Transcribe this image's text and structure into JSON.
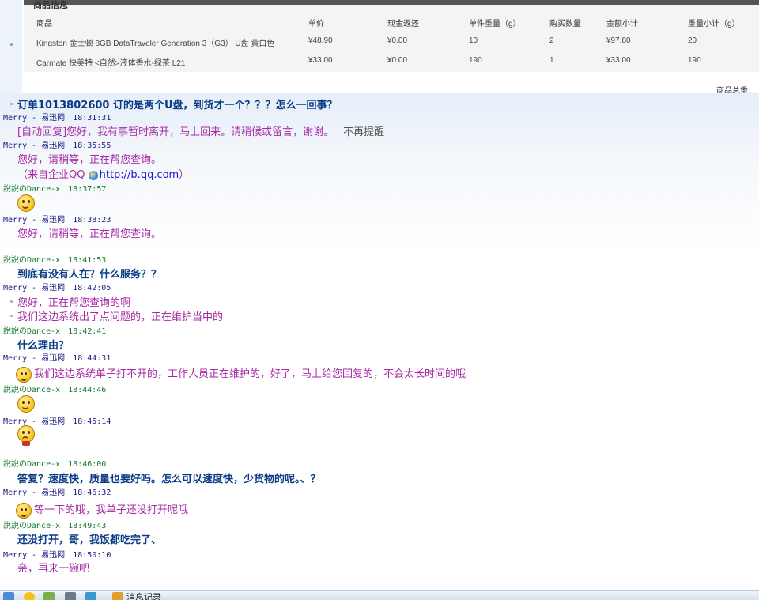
{
  "order": {
    "section_title_cut": "商品信息",
    "columns": [
      "商品",
      "单价",
      "现金返还",
      "单件重量（g）",
      "购买数量",
      "金额小计",
      "重量小计（g）"
    ],
    "rows": [
      [
        "Kingston 金士顿 8GB DataTraveler Generation 3（G3） U盘 黄白色",
        "¥48.90",
        "¥0.00",
        "10",
        "2",
        "¥97.80",
        "20"
      ],
      [
        "Carmate 快美特 <自然>液体香水-绿茶 L21",
        "¥33.00",
        "¥0.00",
        "190",
        "1",
        "¥33.00",
        "190"
      ]
    ],
    "footer_label": "商品总重："
  },
  "chat": [
    {
      "type": "text",
      "role": "cust",
      "text": "订单1013802600 订的是两个U盘，到货才一个？？？怎么一回事？"
    },
    {
      "type": "header",
      "role": "merry",
      "name": "Merry - 易迅网",
      "time": "18:31:31"
    },
    {
      "type": "text",
      "role": "agent",
      "text": "[自动回复]您好，我有事暂时离开，马上回来。请稍候或留言，谢谢。",
      "extra": "不再提醒"
    },
    {
      "type": "header",
      "role": "merry",
      "name": "Merry - 易迅网",
      "time": "18:35:55"
    },
    {
      "type": "text",
      "role": "agent",
      "text": "您好，请稍等，正在帮您查询。"
    },
    {
      "type": "text",
      "role": "agent",
      "text": "（来自企业QQ ",
      "link": "http://b.qq.com",
      "suffix": "）"
    },
    {
      "type": "header",
      "role": "dance",
      "name": "說說のDance-x",
      "time": "18:37:57"
    },
    {
      "type": "emoticon",
      "icon": "grin-emoticon"
    },
    {
      "type": "header",
      "role": "merry",
      "name": "Merry - 易迅网",
      "time": "18:38:23"
    },
    {
      "type": "text",
      "role": "agent",
      "text": "您好，请稍等，正在帮您查询。"
    },
    {
      "type": "header",
      "role": "dance",
      "name": "說說のDance-x",
      "time": "18:41:53"
    },
    {
      "type": "text",
      "role": "cust",
      "text": "到底有没有人在？什么服务？？"
    },
    {
      "type": "header",
      "role": "merry",
      "name": "Merry - 易迅网",
      "time": "18:42:05"
    },
    {
      "type": "text",
      "role": "agent",
      "text": "您好，正在帮您查询的啊"
    },
    {
      "type": "text",
      "role": "agent",
      "text": "我们这边系统出了点问题的，正在维护当中的"
    },
    {
      "type": "header",
      "role": "dance",
      "name": "說說のDance-x",
      "time": "18:42:41"
    },
    {
      "type": "text",
      "role": "cust",
      "text": "什么理由？"
    },
    {
      "type": "header",
      "role": "merry",
      "name": "Merry - 易迅网",
      "time": "18:44:31"
    },
    {
      "type": "text",
      "role": "agent",
      "text": "我们这边系统单子打不开的，工作人员正在维护的，好了，马上给您回复的，不会太长时间的哦"
    },
    {
      "type": "header",
      "role": "dance",
      "name": "說說のDance-x",
      "time": "18:44:46"
    },
    {
      "type": "emoticon",
      "icon": "shocked-emoticon"
    },
    {
      "type": "header",
      "role": "merry",
      "name": "Merry - 易迅网",
      "time": "18:45:14"
    },
    {
      "type": "emoticon",
      "icon": "sad-bow-emoticon"
    },
    {
      "type": "header",
      "role": "dance",
      "name": "說說のDance-x",
      "time": "18:46:00"
    },
    {
      "type": "text",
      "role": "cust",
      "text": "答复？速度快，质量也要好吗。怎么可以速度快，少货物的呢。、？"
    },
    {
      "type": "header",
      "role": "merry",
      "name": "Merry - 易迅网",
      "time": "18:46:32"
    },
    {
      "type": "text",
      "role": "agent",
      "text": "等一下的哦，我单子还没打开呢哦"
    },
    {
      "type": "header",
      "role": "dance",
      "name": "說說のDance-x",
      "time": "18:49:43"
    },
    {
      "type": "text",
      "role": "cust",
      "text": "还没打开，哥，我饭都吃完了、"
    },
    {
      "type": "header",
      "role": "merry",
      "name": "Merry - 易迅网",
      "time": "18:50:10"
    },
    {
      "type": "text",
      "role": "agent",
      "text": "亲，再来一碗吧"
    }
  ],
  "toolbar": {
    "history_label": "消息记录"
  }
}
